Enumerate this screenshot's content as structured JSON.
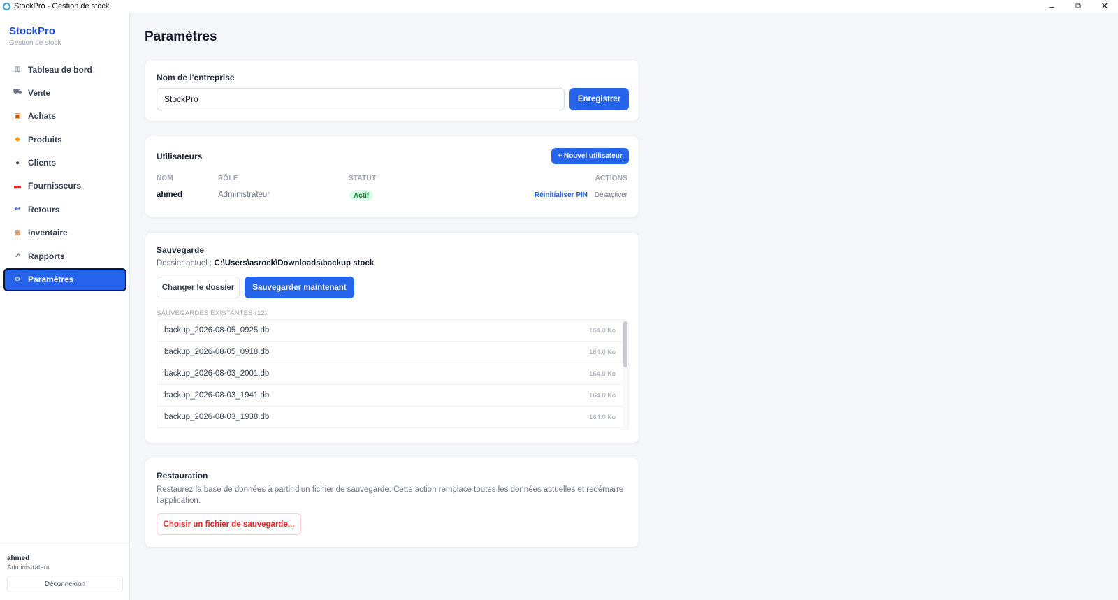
{
  "window": {
    "title": "StockPro - Gestion de stock",
    "minimize": "–",
    "restore": "⧉",
    "close": "✕"
  },
  "sidebar": {
    "brand_title": "StockPro",
    "brand_subtitle": "Gestion de stock",
    "items": [
      {
        "label": "Tableau de bord",
        "icon": "bar-chart-icon",
        "glyph": "▥",
        "color": "#6b7280"
      },
      {
        "label": "Vente",
        "icon": "cart-icon",
        "glyph": "⛟",
        "color": "#6b7280"
      },
      {
        "label": "Achats",
        "icon": "package-icon",
        "glyph": "▣",
        "color": "#b45309"
      },
      {
        "label": "Produits",
        "icon": "tag-icon",
        "glyph": "◆",
        "color": "#f59e0b"
      },
      {
        "label": "Clients",
        "icon": "user-icon",
        "glyph": "●",
        "color": "#4b5563"
      },
      {
        "label": "Fournisseurs",
        "icon": "truck-icon",
        "glyph": "▬",
        "color": "#dc2626"
      },
      {
        "label": "Retours",
        "icon": "return-icon",
        "glyph": "↩",
        "color": "#2563eb"
      },
      {
        "label": "Inventaire",
        "icon": "clipboard-icon",
        "glyph": "▤",
        "color": "#b45309"
      },
      {
        "label": "Rapports",
        "icon": "line-chart-icon",
        "glyph": "↗",
        "color": "#6b7280"
      },
      {
        "label": "Paramètres",
        "icon": "gear-icon",
        "glyph": "⚙",
        "color": "#ffffff"
      }
    ],
    "active_index": 9,
    "user_name": "ahmed",
    "user_role": "Administrateur",
    "logout_label": "Déconnexion"
  },
  "page": {
    "title": "Paramètres"
  },
  "company": {
    "label": "Nom de l'entreprise",
    "value": "StockPro",
    "save_label": "Enregistrer"
  },
  "users": {
    "title": "Utilisateurs",
    "new_user_label": "+ Nouvel utilisateur",
    "columns": {
      "name": "NOM",
      "role": "RÔLE",
      "status": "STATUT",
      "actions": "ACTIONS"
    },
    "rows": [
      {
        "name": "ahmed",
        "role": "Administrateur",
        "status": "Actif",
        "reset_pin": "Réinitialiser PIN",
        "deactivate": "Désactiver"
      }
    ]
  },
  "backup": {
    "title": "Sauvegarde",
    "folder_prefix": "Dossier actuel : ",
    "folder_path": "C:\\Users\\asrock\\Downloads\\backup stock",
    "change_folder_label": "Changer le dossier",
    "backup_now_label": "Sauvegarder maintenant",
    "existing_label": "SAUVEGARDES EXISTANTES (12)",
    "files": [
      {
        "name": "backup_2026-08-05_0925.db",
        "size": "164.0 Ko"
      },
      {
        "name": "backup_2026-08-05_0918.db",
        "size": "164.0 Ko"
      },
      {
        "name": "backup_2026-08-03_2001.db",
        "size": "164.0 Ko"
      },
      {
        "name": "backup_2026-08-03_1941.db",
        "size": "164.0 Ko"
      },
      {
        "name": "backup_2026-08-03_1938.db",
        "size": "164.0 Ko"
      }
    ]
  },
  "restore": {
    "title": "Restauration",
    "description": "Restaurez la base de données à partir d'un fichier de sauvegarde. Cette action remplace toutes les données actuelles et redémarre l'application.",
    "choose_file_label": "Choisir un fichier de sauvegarde..."
  },
  "colors": {
    "accent": "#2563eb",
    "brand": "#1d4ed8",
    "danger": "#dc2626",
    "success_bg": "#dcfce7",
    "success_text": "#15803d"
  }
}
